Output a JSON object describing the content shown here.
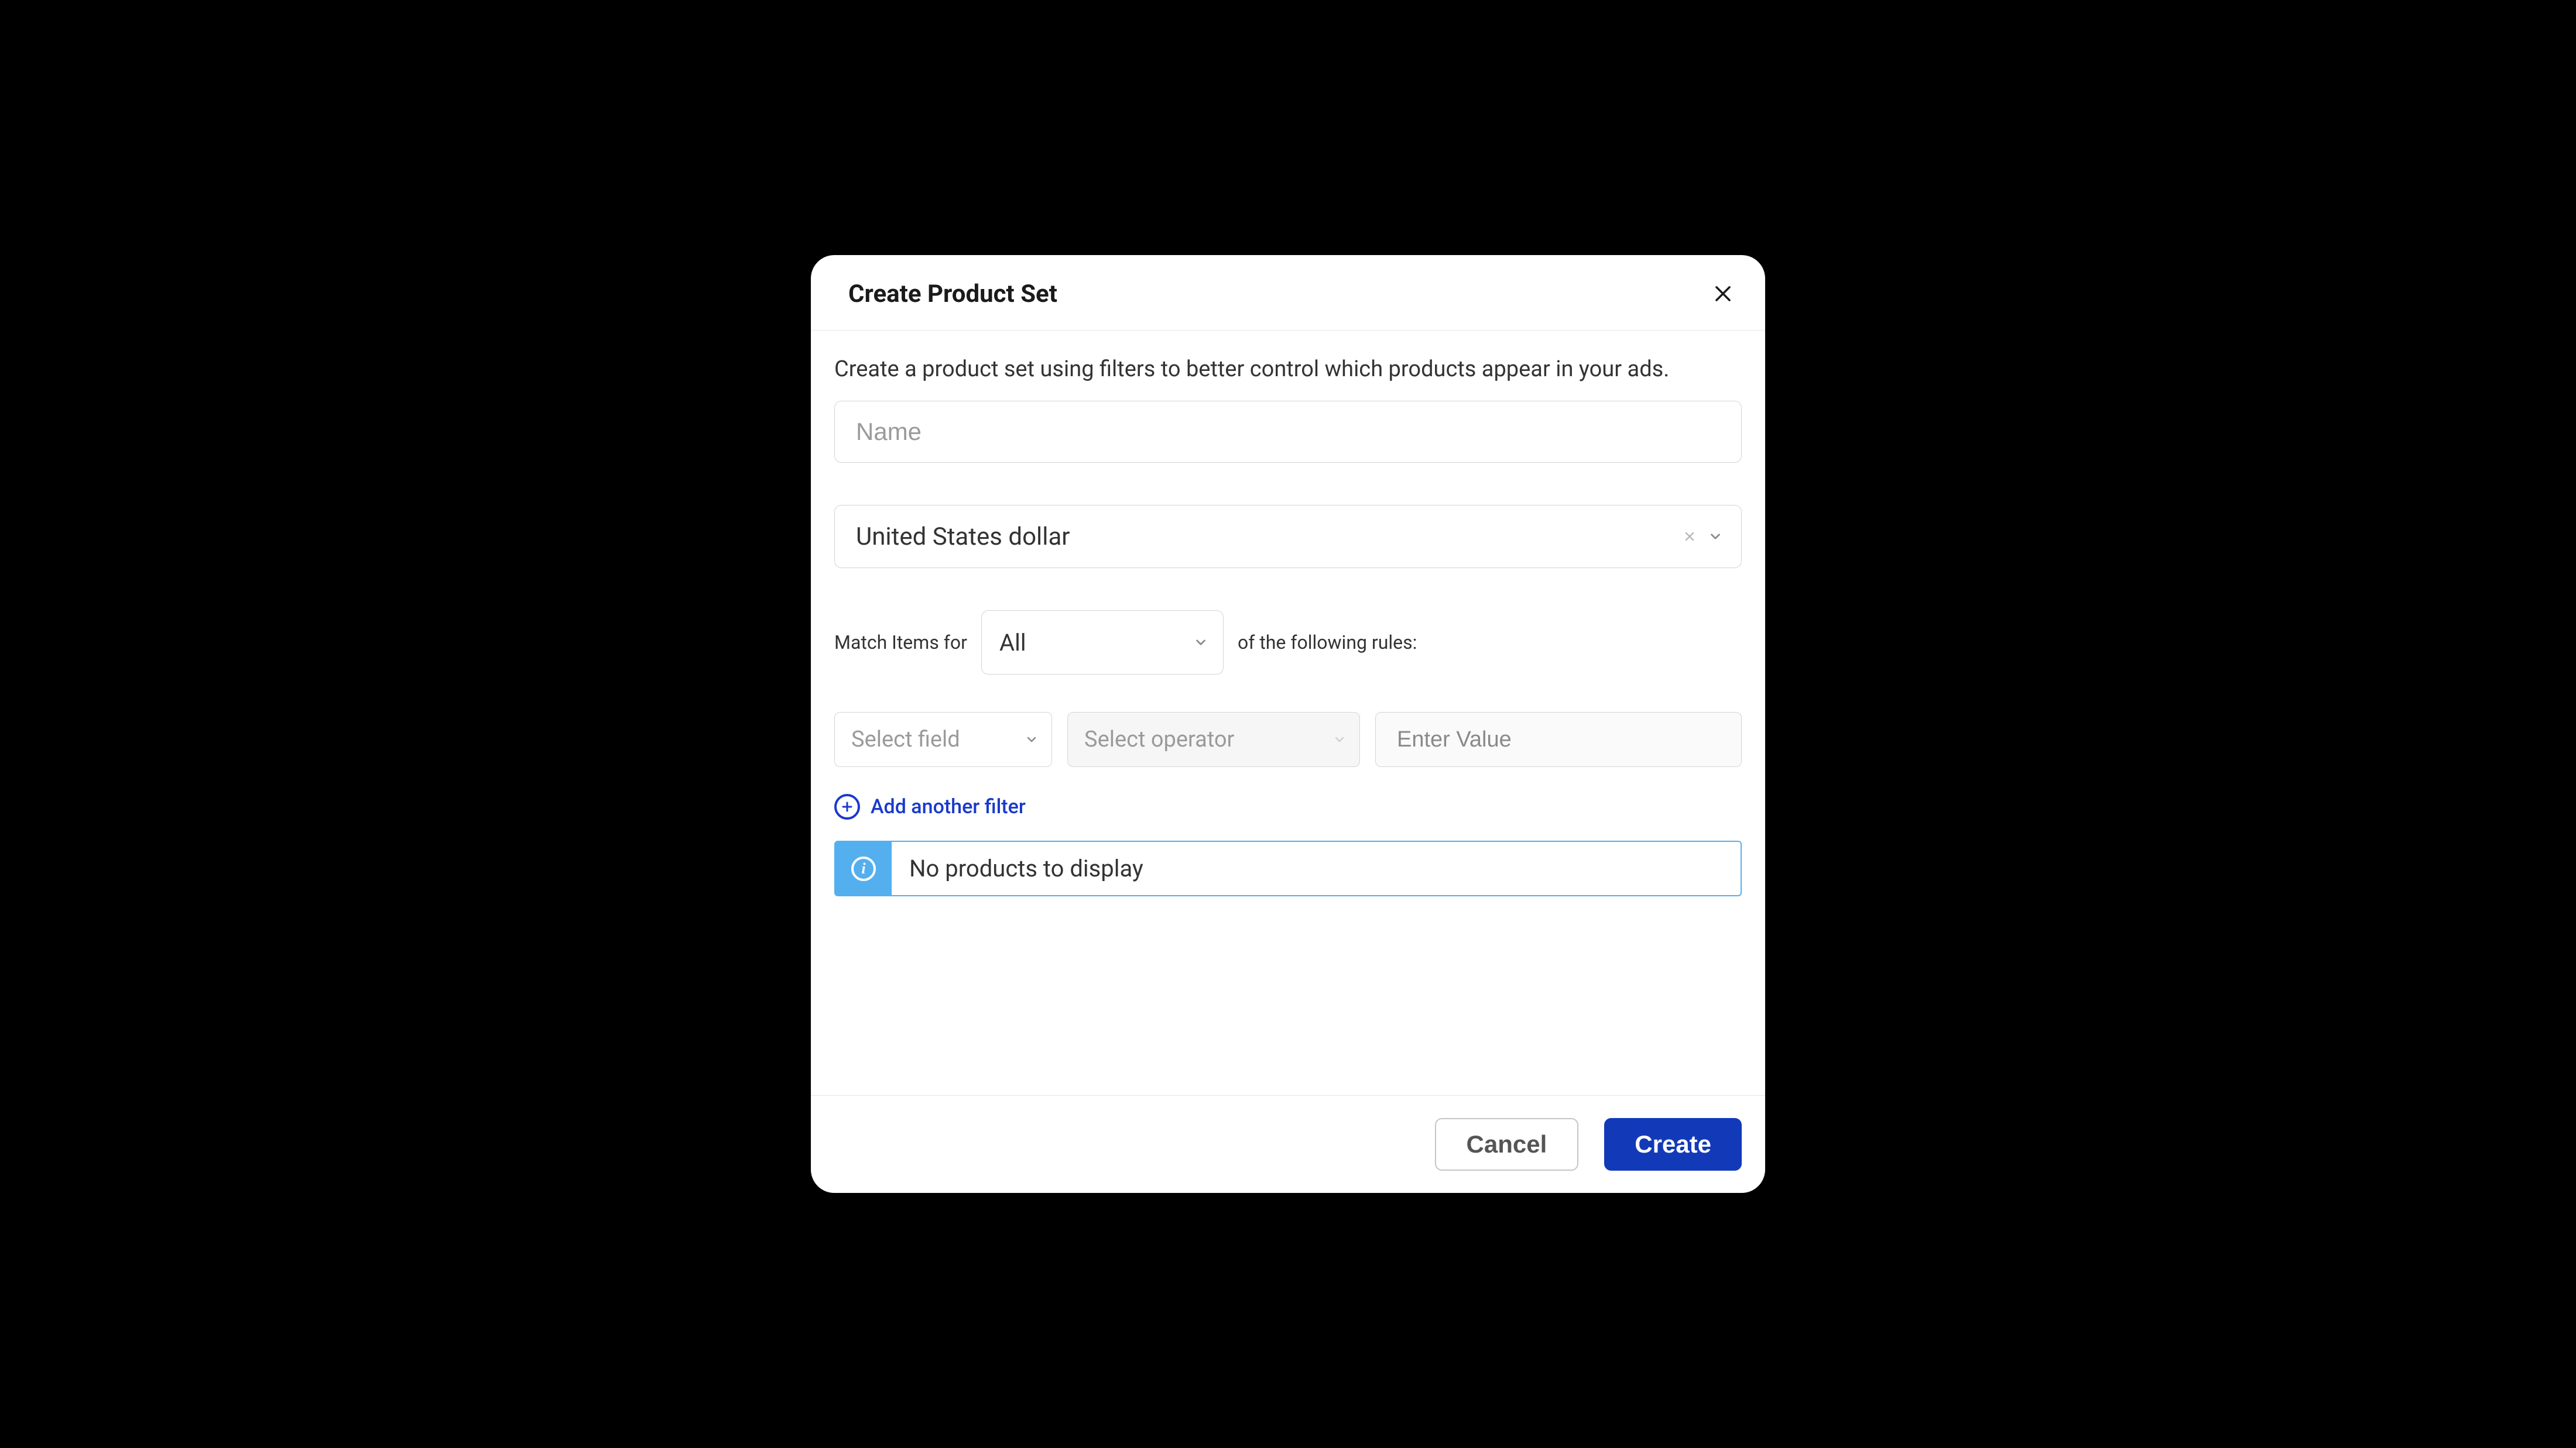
{
  "dialog": {
    "title": "Create Product Set",
    "description": "Create a product set using filters to better control which products appear in your ads.",
    "name_placeholder": "Name",
    "name_value": "",
    "currency_value": "United States dollar",
    "match": {
      "prefix_label": "Match Items for",
      "select_value": "All",
      "suffix_label": "of the following rules:"
    },
    "filter": {
      "field_placeholder": "Select field",
      "operator_placeholder": "Select operator",
      "value_placeholder": "Enter Value"
    },
    "add_filter_label": "Add another filter",
    "info_message": "No products to display",
    "footer": {
      "cancel_label": "Cancel",
      "create_label": "Create"
    }
  }
}
